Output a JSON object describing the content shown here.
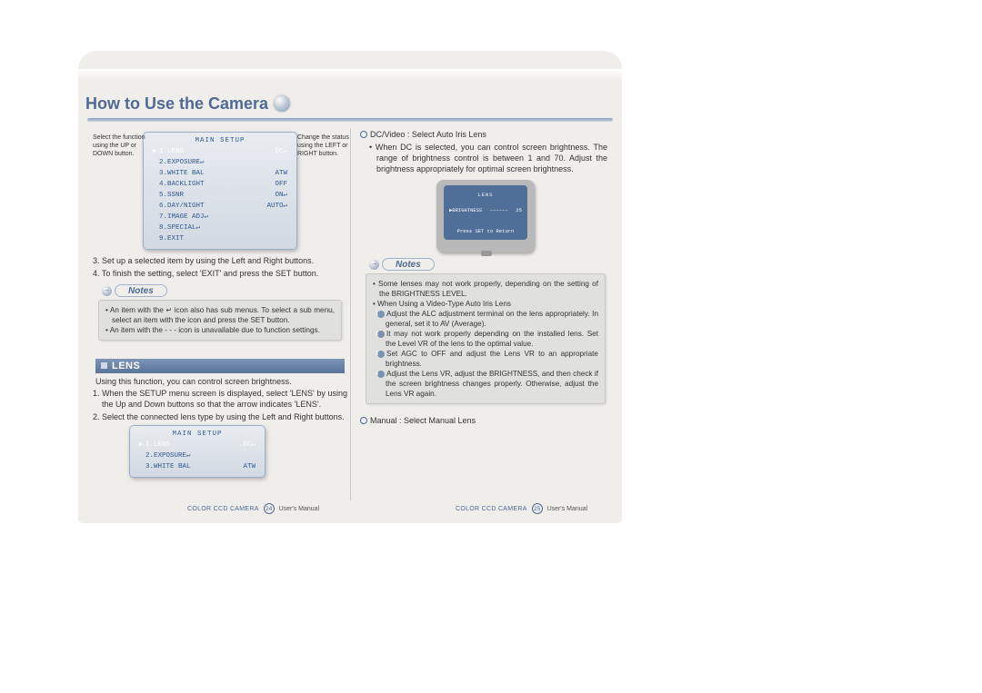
{
  "title": "How to Use the Camera",
  "left": {
    "sidenote_left": "Select the function using the UP or DOWN button.",
    "sidenote_right": "Change the status using the LEFT or RIGHT button.",
    "osd_main": {
      "title": "MAIN SETUP",
      "items": [
        {
          "label": "1.LENS",
          "value": "DC↵",
          "sel": true
        },
        {
          "label": "2.EXPOSURE↵",
          "value": ""
        },
        {
          "label": "3.WHITE BAL",
          "value": "ATW"
        },
        {
          "label": "4.BACKLIGHT",
          "value": "OFF"
        },
        {
          "label": "5.SSNR",
          "value": "ON↵"
        },
        {
          "label": "6.DAY/NIGHT",
          "value": "AUTO↵"
        },
        {
          "label": "7.IMAGE ADJ↵",
          "value": ""
        },
        {
          "label": "8.SPECIAL↵",
          "value": ""
        },
        {
          "label": "9.EXIT",
          "value": ""
        }
      ]
    },
    "step3": "3. Set up a selected item by using the Left and Right buttons.",
    "step4": "4. To finish the setting, select 'EXIT' and press the SET button.",
    "notes_label": "Notes",
    "note1": "• An item with the ↵ icon also has sub menus. To select a sub menu, select an item with the icon and press the SET button.",
    "note2": "• An item with the - - - icon is unavailable due to function settings.",
    "section": "LENS",
    "intro": "Using this function, you can control screen brightness.",
    "step_l1": "1. When the SETUP menu screen is displayed, select 'LENS' by using the Up and Down buttons so that the arrow indicates 'LENS'.",
    "step_l2": "2. Select the connected lens type by using the Left and Right buttons.",
    "osd_small": {
      "title": "MAIN SETUP",
      "items": [
        {
          "label": "1.LENS",
          "value": "DC↵",
          "sel": true
        },
        {
          "label": "2.EXPOSURE↵",
          "value": ""
        },
        {
          "label": "3.WHITE BAL",
          "value": "ATW"
        }
      ]
    }
  },
  "right": {
    "dc_head": "DC/Video : Select Auto Iris Lens",
    "dc_body": "• When DC is selected, you can control screen brightness. The range of brightness control is between 1 and 70. Adjust the brightness appropriately for optimal screen brightness.",
    "crt": {
      "title": "LENS",
      "row_label": "▶BRIGHTNESS",
      "row_gauge": "––––––",
      "row_value": "25",
      "return": "Press SET to Return"
    },
    "notes_label": "Notes",
    "n1": "• Some lenses may not work properly, depending on the setting of the BRIGHTNESS LEVEL.",
    "n2": "• When Using a Video-Type Auto Iris Lens",
    "n2a_num": "1",
    "n2a": "Adjust the ALC adjustment terminal on the lens appropriately. In general, set it to AV (Average).",
    "n2b_num": "2",
    "n2b": "It may not work properly depending on the installed lens. Set the Level VR of the lens to the optimal value.",
    "n2c_num": "3",
    "n2c": "Set AGC to OFF and adjust the Lens VR to an appropriate brightness.",
    "n2d_num": "4",
    "n2d": "Adjust the Lens VR, adjust the BRIGHTNESS, and then check if the screen brightness changes properly. Otherwise, adjust the Lens VR again.",
    "manual": "Manual : Select Manual Lens"
  },
  "footer": {
    "model": "COLOR CCD CAMERA",
    "left_page": "24",
    "right_page": "25",
    "suffix": "User's Manual"
  }
}
